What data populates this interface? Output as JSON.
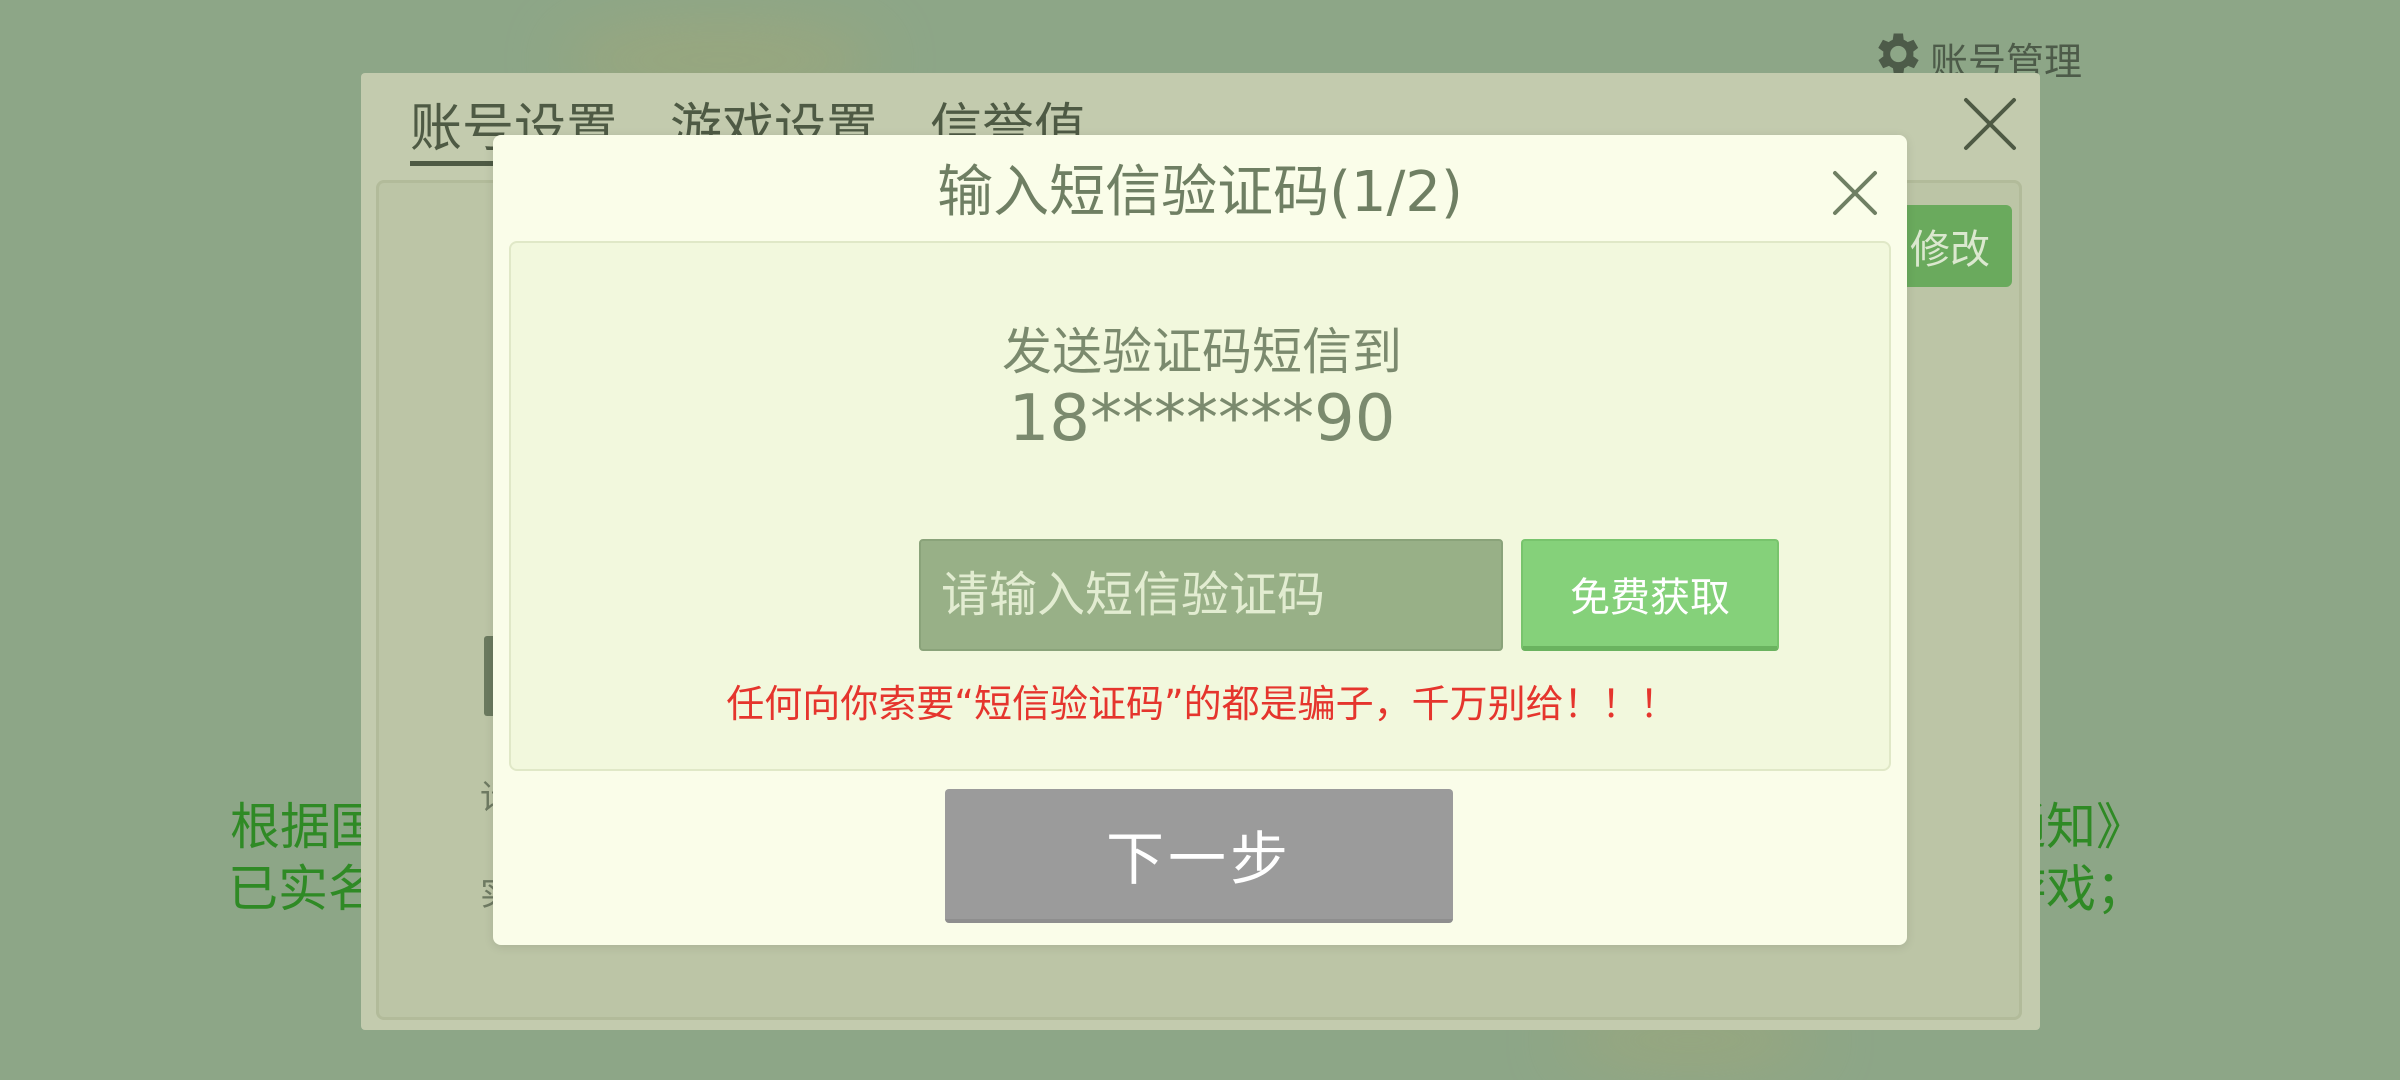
{
  "account_management": {
    "label": "账号管理",
    "icon": "gear-icon"
  },
  "settings": {
    "tabs": [
      {
        "label": "账号设置",
        "active": true
      },
      {
        "label": "游戏设置",
        "active": false
      },
      {
        "label": "信誉值",
        "active": false
      }
    ],
    "modify_label": "修改",
    "partial_text": {
      "line1": "请",
      "line2": "实"
    }
  },
  "background_notice": {
    "left_line1": "根据国",
    "left_line2": "已实名",
    "right_line1": "通知》",
    "right_line2": "游戏；"
  },
  "sms_dialog": {
    "title": "输入短信验证码(1/2)",
    "send_label": "发送验证码短信到",
    "phone": "18*******90",
    "input_placeholder": "请输入短信验证码",
    "input_value": "",
    "get_code_label": "免费获取",
    "warning": "任何向你索要“短信验证码”的都是骗子，千万别给！！！",
    "next_label": "下一步"
  },
  "colors": {
    "warning": "#e5352d",
    "get_code_button": "#85d17a",
    "next_button_disabled": "#9b9b9b",
    "dialog_background": "#fafde9",
    "notice_green": "#2f8a25"
  }
}
